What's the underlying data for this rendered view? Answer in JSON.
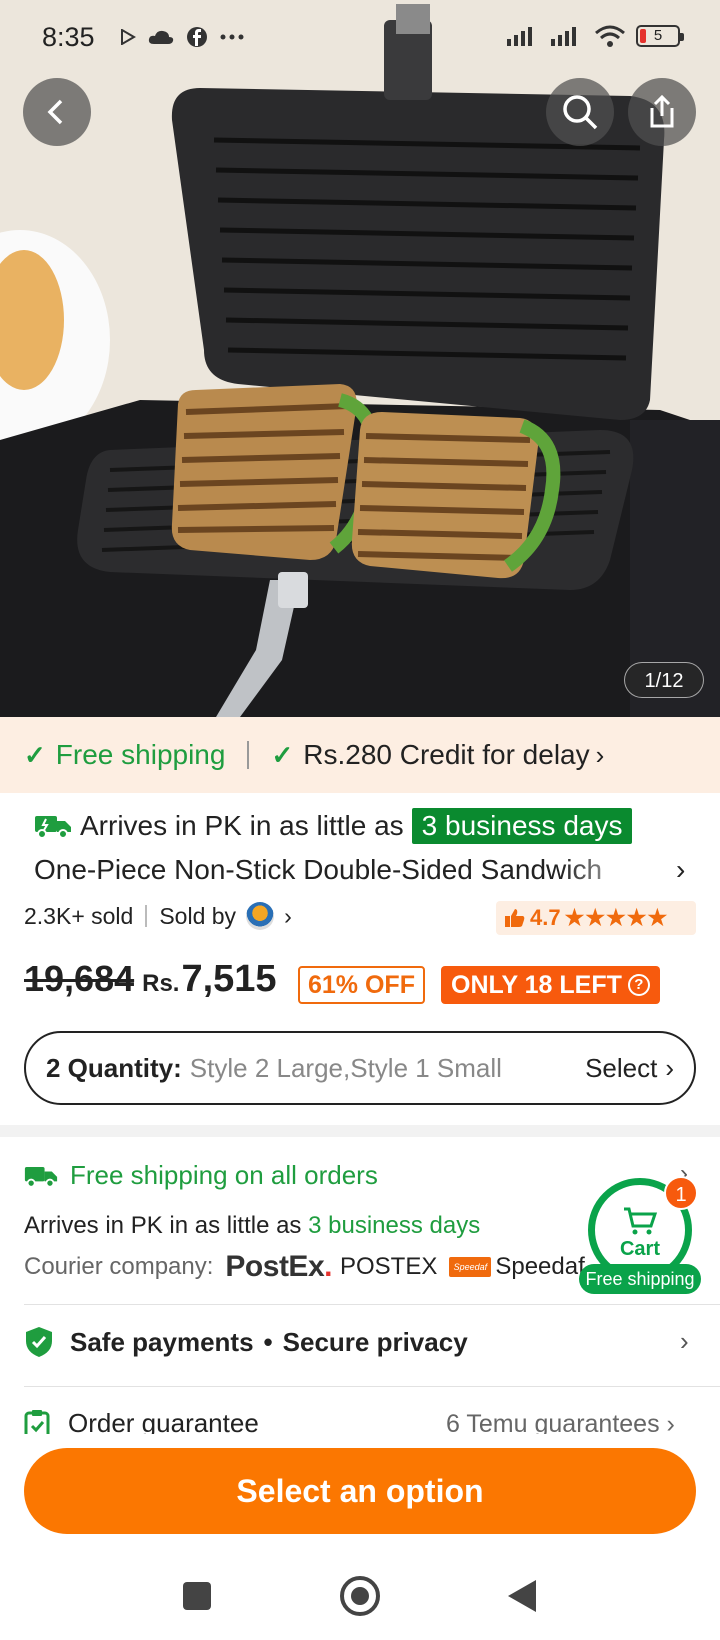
{
  "status_bar": {
    "time": "8:35",
    "left_icons": [
      "play-icon",
      "cloud-icon",
      "facebook-icon",
      "more-dots-icon"
    ],
    "battery": "5"
  },
  "hero": {
    "image_counter": "1/12",
    "image_subject": "sandwich-grill-pan-icon"
  },
  "shipping_strip": {
    "free_shipping": "Free shipping",
    "credit": "Rs.280 Credit for delay"
  },
  "product": {
    "arrive_prefix": "Arrives in PK in as little as",
    "arrive_days": "3 business days",
    "title": "One-Piece Non-Stick Double-Sided Sandwich",
    "sold": "2.3K+ sold",
    "sold_by": "Sold by",
    "rating": "4.7",
    "stars": "★★★★★",
    "old_price": "19,684",
    "currency": "Rs.",
    "price": "7,515",
    "discount": "61% OFF",
    "stock": "ONLY 18 LEFT",
    "stock_help": "?"
  },
  "quantity": {
    "label": "2 Quantity:",
    "value": "Style 2 Large,Style 1 Small",
    "select": "Select"
  },
  "shipping_details": {
    "free_all": "Free shipping on all orders",
    "arrive_prefix": "Arrives in PK in as little as",
    "arrive_days": "3 business days",
    "courier_label": "Courier company:",
    "postex_logo": "PostEx",
    "postex_name": "POSTEX",
    "speedaf_logo": "Speedaf",
    "speedaf_name": "Speedaf"
  },
  "cart": {
    "label": "Cart",
    "count": "1",
    "free_shipping": "Free shipping"
  },
  "safe": {
    "payments": "Safe payments",
    "privacy": "Secure privacy"
  },
  "order": {
    "label": "Order guarantee",
    "guarantees": "6 Temu guarantees"
  },
  "cta": {
    "label": "Select an option"
  },
  "colors": {
    "brand_orange": "#fb7701",
    "green": "#1f9d3f",
    "strip_bg": "#fdeee2"
  }
}
